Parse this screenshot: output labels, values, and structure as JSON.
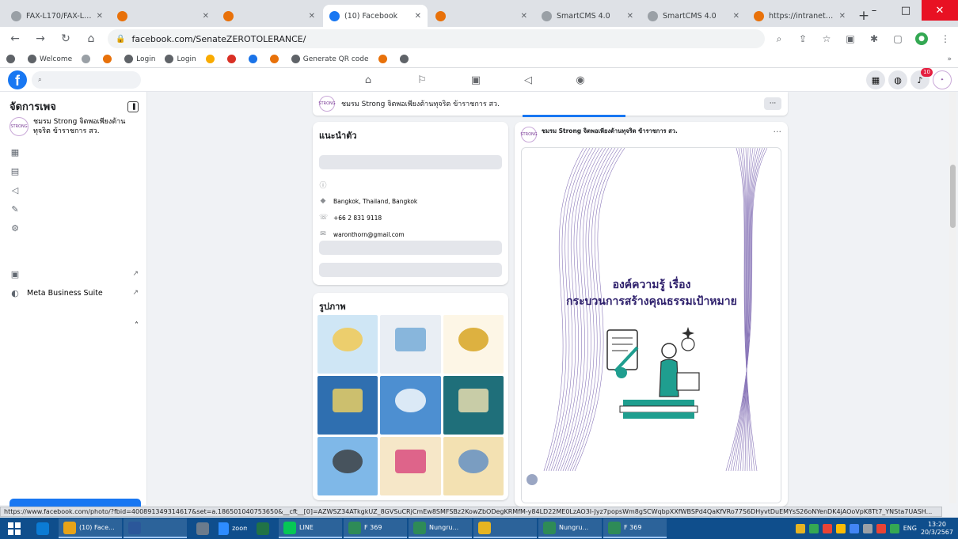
{
  "browser": {
    "tabs": [
      {
        "title": "FAX-L170/FAX-L150 |",
        "color": "#9aa0a6",
        "active": false
      },
      {
        "title": "",
        "color": "#e8710a",
        "active": false
      },
      {
        "title": "",
        "color": "#e8710a",
        "active": false
      },
      {
        "title": "(10) Facebook",
        "color": "#1877f2",
        "active": true
      },
      {
        "title": "",
        "color": "#e8710a",
        "active": false
      },
      {
        "title": "SmartCMS 4.0",
        "color": "#9aa0a6",
        "active": false
      },
      {
        "title": "SmartCMS 4.0",
        "color": "#9aa0a6",
        "active": false
      },
      {
        "title": "https://intranet.sen",
        "color": "#e8710a",
        "active": false
      }
    ],
    "new_tab_glyph": "+",
    "window_controls": {
      "minimize": "–",
      "maximize": "□",
      "close": "✕"
    },
    "url": "facebook.com/SenateZEROTOLERANCE/",
    "bookmarks": [
      {
        "label": "",
        "color": "#5f6368"
      },
      {
        "label": "Welcome",
        "color": "#5f6368"
      },
      {
        "label": "",
        "color": "#9aa0a6"
      },
      {
        "label": "",
        "color": "#e8710a"
      },
      {
        "label": "Login",
        "color": "#5f6368"
      },
      {
        "label": "Login",
        "color": "#5f6368"
      },
      {
        "label": "",
        "color": "#f9ab00"
      },
      {
        "label": "",
        "color": "#d93025"
      },
      {
        "label": "",
        "color": "#1a73e8"
      },
      {
        "label": "",
        "color": "#e8710a"
      },
      {
        "label": "Generate QR code",
        "color": "#5f6368"
      },
      {
        "label": "",
        "color": "#e8710a"
      },
      {
        "label": "",
        "color": "#5f6368"
      }
    ],
    "bookmarks_more": "»"
  },
  "facebook": {
    "search_placeholder": "",
    "right_icons": [
      "grid-menu-icon",
      "messenger-icon",
      "bell-icon"
    ],
    "notification_count": "10"
  },
  "sidebar": {
    "title": "จัดการเพจ",
    "page_name": "ชมรม Strong จิตพอเพียงต้านทุจริต ข้าราชการ สว.",
    "avatar_text": "STRONG",
    "items": [
      {
        "icon": "dashboard-icon",
        "glyph": "▦",
        "label": "",
        "ext": ""
      },
      {
        "icon": "insights-icon",
        "glyph": "▤",
        "label": "",
        "ext": ""
      },
      {
        "icon": "ad-center-icon",
        "glyph": "◁",
        "label": "",
        "ext": ""
      },
      {
        "icon": "create-ad-icon",
        "glyph": "✎",
        "label": "",
        "ext": ""
      },
      {
        "icon": "settings-icon",
        "glyph": "⚙",
        "label": "",
        "ext": ""
      }
    ],
    "tools_title": "",
    "tools_chevron": "˄",
    "tools_items": [
      {
        "icon": "audience-icon",
        "glyph": "▣",
        "label": "",
        "ext": "↗"
      },
      {
        "icon": "meta-business-icon",
        "glyph": "◐",
        "label": "Meta Business Suite",
        "ext": "↗"
      }
    ]
  },
  "main": {
    "page_bar_name": "ชมรม Strong จิตพอเพียงต้านทุจริต ข้าราชการ สว.",
    "page_bar_more": "···",
    "intro": {
      "title": "แนะนำตัว",
      "description": "",
      "edit_bio_label": "",
      "rows": [
        {
          "icon": "info-icon",
          "glyph": "ⓘ",
          "text": ""
        },
        {
          "icon": "location-icon",
          "glyph": "◆",
          "text": "Bangkok, Thailand, Bangkok"
        },
        {
          "icon": "phone-icon",
          "glyph": "☏",
          "text": "+66 2 831 9118"
        },
        {
          "icon": "email-icon",
          "glyph": "✉",
          "text": "waronthorn@gmail.com"
        }
      ],
      "edit_details_label": "",
      "add_featured_label": ""
    },
    "photos": {
      "title": "รูปภาพ",
      "see_all": "",
      "tiles": [
        {
          "bg": "#cfe6f5",
          "accent": "#f3c84b",
          "caption": ""
        },
        {
          "bg": "#e9eef4",
          "accent": "#6fa8d6",
          "caption": ""
        },
        {
          "bg": "#fdf6e6",
          "accent": "#d4a017",
          "caption": ""
        },
        {
          "bg": "#2f6fb0",
          "accent": "#f4d35e",
          "caption": ""
        },
        {
          "bg": "#4d8fd1",
          "accent": "#ffffff",
          "caption": ""
        },
        {
          "bg": "#1f6f7a",
          "accent": "#f2e3b3",
          "caption": ""
        },
        {
          "bg": "#7fb8e8",
          "accent": "#3a3a3a",
          "caption": ""
        },
        {
          "bg": "#f6e7c8",
          "accent": "#d8437a",
          "caption": ""
        },
        {
          "bg": "#f3e1b2",
          "accent": "#5b8cc4",
          "caption": ""
        }
      ]
    },
    "post": {
      "author": "ชมรม Strong จิตพอเพียงต้านทุจริต ข้าราชการ สว.",
      "time": "",
      "more": "···",
      "image_title_1": "องค์ความรู้ เรื่อง",
      "image_title_2": "กระบวนการสร้างคุณธรรมเป้าหมาย",
      "shared_author": "",
      "shared_time": "",
      "shared_text": ""
    }
  },
  "status_url": "https://www.facebook.com/photo/?fbid=400891349314617&set=a.186501040753650&__cft__[0]=AZWSZ34ATkgkUZ_8GVSuCRjCmEw8SMFSBz2KowZbODegKRMfM-y84LD22ME0LzAO3I-Jyz7popsWm8gSCWqbpXXfWBSPd4QaKfVRo77S6DHyvtDuEMYsS26oNYenDK4jAOoVpK8Tt7_YNSta7UASH...",
  "taskbar": {
    "apps": [
      {
        "icon": "edge-icon",
        "label": "",
        "color": "#0b7bd4",
        "wide": false
      },
      {
        "icon": "chrome-icon",
        "label": "(10) Face...",
        "color": "#e8a317",
        "wide": true
      },
      {
        "icon": "word-icon",
        "label": "",
        "color": "#2b579a",
        "wide": true
      },
      {
        "icon": "app-icon",
        "label": "",
        "color": "#6b7b8c",
        "wide": false
      },
      {
        "icon": "zoom-icon",
        "label": "zoom",
        "color": "#2d8cff",
        "wide": false
      },
      {
        "icon": "excel-icon",
        "label": "",
        "color": "#217346",
        "wide": false
      },
      {
        "icon": "line-icon",
        "label": "LINE",
        "color": "#06c755",
        "wide": true
      },
      {
        "icon": "user-icon",
        "label": "F 369",
        "color": "#2e8b57",
        "wide": true
      },
      {
        "icon": "user-icon",
        "label": "Nungru...",
        "color": "#2e8b57",
        "wide": true
      },
      {
        "icon": "folder-icon",
        "label": "",
        "color": "#e6b422",
        "wide": true
      },
      {
        "icon": "photos-icon",
        "label": "Nungru...",
        "color": "#2e8b57",
        "wide": true
      },
      {
        "icon": "photos-icon",
        "label": "F 369",
        "color": "#2e8b57",
        "wide": true
      }
    ],
    "tray_colors": [
      "#e6b422",
      "#34a853",
      "#ea4335",
      "#fbbc05",
      "#4285f4",
      "#9aa0a6",
      "#ea4335",
      "#34a853"
    ],
    "language": "ENG",
    "time": "13:20",
    "date": "20/3/2567"
  }
}
